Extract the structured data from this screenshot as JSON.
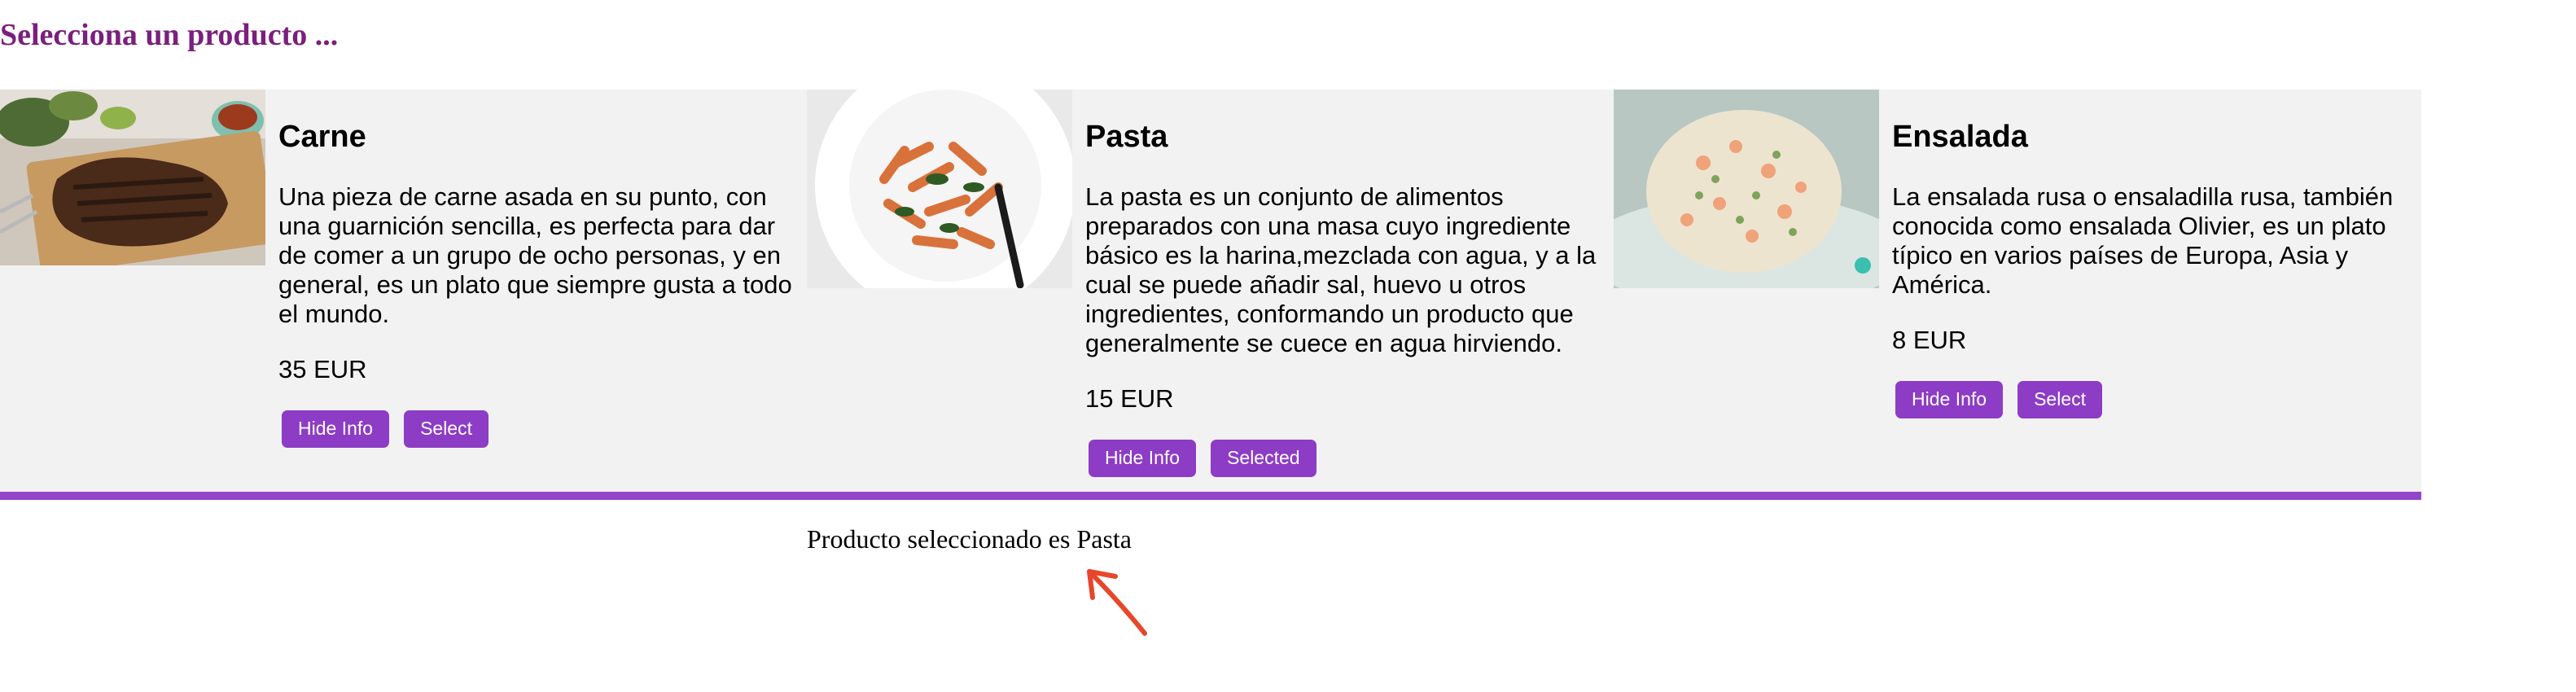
{
  "page": {
    "title": "Selecciona un producto ..."
  },
  "products": [
    {
      "name": "Carne",
      "description": "Una pieza de carne asada en su punto, con una guarnición sencilla, es perfecta para dar de comer a un grupo de ocho personas, y en general, es un plato que siempre gusta a todo el mundo.",
      "price": "35 EUR",
      "info_button": "Hide Info",
      "select_button": "Select",
      "image": "grilled-steak-photo"
    },
    {
      "name": "Pasta",
      "description": "La pasta es un conjunto de alimentos preparados con una masa cuyo ingrediente básico es la harina,mezclada con agua, y a la cual se puede añadir sal, huevo u otros ingredientes, conformando un producto que generalmente se cuece en agua hirviendo.",
      "price": "15 EUR",
      "info_button": "Hide Info",
      "select_button": "Selected",
      "image": "penne-pasta-photo"
    },
    {
      "name": "Ensalada",
      "description": "La ensalada rusa o ensaladilla rusa, también conocida como ensalada Olivier, es un plato típico en varios países de Europa, Asia y América.",
      "price": "8 EUR",
      "info_button": "Hide Info",
      "select_button": "Select",
      "image": "russian-salad-photo"
    }
  ],
  "footer": {
    "selected_message": "Producto seleccionado es Pasta"
  },
  "colors": {
    "title": "#7a1f7e",
    "button": "#8d3cc6",
    "divider": "#9446c9",
    "panel_background": "#f2f2f2",
    "annotation_arrow": "#e8462a"
  }
}
